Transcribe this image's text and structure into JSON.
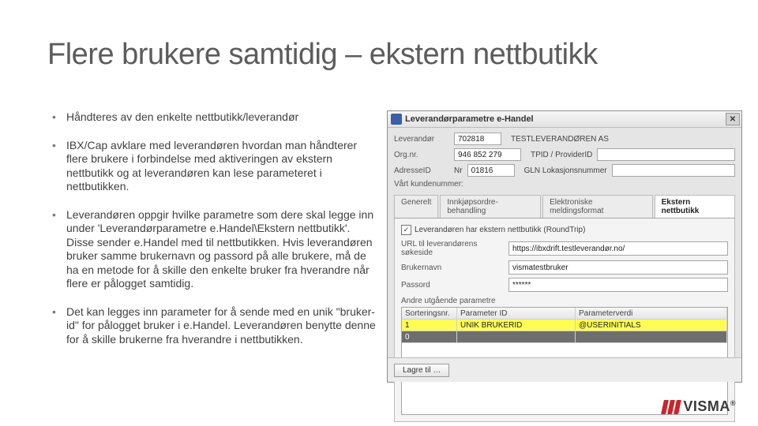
{
  "title": "Flere brukere samtidig – ekstern nettbutikk",
  "bullets": [
    "Håndteres av den enkelte nettbutikk/leverandør",
    "IBX/Cap avklare med leverandøren hvordan man håndterer flere brukere i forbindelse med aktiveringen av ekstern nettbutikk og at leverandøren kan lese parameteret i nettbutikken.",
    "Leverandøren oppgir hvilke parametre som dere skal legge inn under 'Leverandørparametre e.Handel\\Ekstern nettbutikk'. Disse sender e.Handel med til nettbutikken. Hvis leverandøren bruker samme brukernavn og passord på alle brukere, må de ha en metode for å skille den enkelte bruker fra hverandre når flere er pålogget samtidig.",
    "Det kan legges inn parameter for å sende med en unik \"bruker-id\" for pålogget bruker i e.Handel. Leverandøren benytte denne for å skille brukerne fra hverandre i nettbutikken."
  ],
  "dialog": {
    "title": "Leverandørparametre e-Handel",
    "close": "✕",
    "fields": {
      "leverandor_label": "Leverandør",
      "leverandor_value": "702818",
      "leverandor_name": "TESTLEVERANDØREN AS",
      "orgnr_label": "Org.nr.",
      "orgnr_value": "946 852 279",
      "tpid_label": "TPID / ProviderID",
      "adresseid_label": "AdresseID",
      "adresseid_prefix": "Nr",
      "adresseid_value": "01816",
      "gln_label": "GLN Lokasjonsnummer",
      "kunde_label": "Vårt kundenummer:"
    },
    "tabs": [
      "Generelt",
      "Innkjøpsordre-behandling",
      "Elektroniske meldingsformat",
      "Ekstern nettbutikk"
    ],
    "active_tab": 3,
    "checkbox_label": "Leverandøren har ekstern nettbutikk (RoundTrip)",
    "url_label": "URL til leverandørens søkeside",
    "url_value": "https://ibxdrift.testleverandør.no/",
    "user_label": "Brukernavn",
    "user_value": "vismatestbruker",
    "pass_label": "Passord",
    "pass_value": "******",
    "param_heading": "Andre utgående parametre",
    "grid_headers": [
      "Sorteringsnr.",
      "Parameter ID",
      "Parameterverdi"
    ],
    "grid_row_hi": [
      "1",
      "UNIK BRUKERID",
      "@USERINITIALS"
    ],
    "grid_row_sel": "0",
    "save_button": "Lagre til …"
  },
  "logo_text": "VISMA"
}
